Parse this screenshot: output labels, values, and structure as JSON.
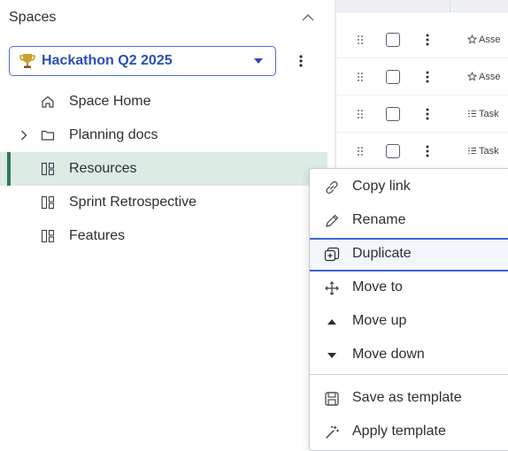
{
  "sidebar": {
    "title": "Spaces",
    "space": {
      "name": "Hackathon Q2 2025"
    },
    "items": [
      {
        "label": "Space Home",
        "icon": "home-icon"
      },
      {
        "label": "Planning docs",
        "icon": "folder-icon"
      },
      {
        "label": "Resources",
        "icon": "board-icon",
        "active": true
      },
      {
        "label": "Sprint Retrospective",
        "icon": "board-icon"
      },
      {
        "label": "Features",
        "icon": "board-icon"
      }
    ]
  },
  "table": {
    "rows": [
      {
        "type": "Asse",
        "icon": "star-icon"
      },
      {
        "type": "Asse",
        "icon": "star-icon"
      },
      {
        "type": "Task",
        "icon": "checklist-icon"
      },
      {
        "type": "Task",
        "icon": "checklist-icon"
      }
    ]
  },
  "context_menu": {
    "items": [
      {
        "label": "Copy link",
        "icon": "link-icon"
      },
      {
        "label": "Rename",
        "icon": "pencil-icon"
      },
      {
        "label": "Duplicate",
        "icon": "duplicate-icon",
        "focused": true
      },
      {
        "label": "Move to",
        "icon": "move-arrows-icon"
      },
      {
        "label": "Move up",
        "icon": "caret-up-icon"
      },
      {
        "label": "Move down",
        "icon": "caret-down-icon"
      },
      {
        "label": "Save as template",
        "icon": "save-icon"
      },
      {
        "label": "Apply template",
        "icon": "magic-wand-icon"
      }
    ]
  },
  "colors": {
    "accent": "#3a63d6",
    "active_bg": "#dcebe4",
    "active_bar": "#2e7a56",
    "trophy": "#c9a227"
  }
}
